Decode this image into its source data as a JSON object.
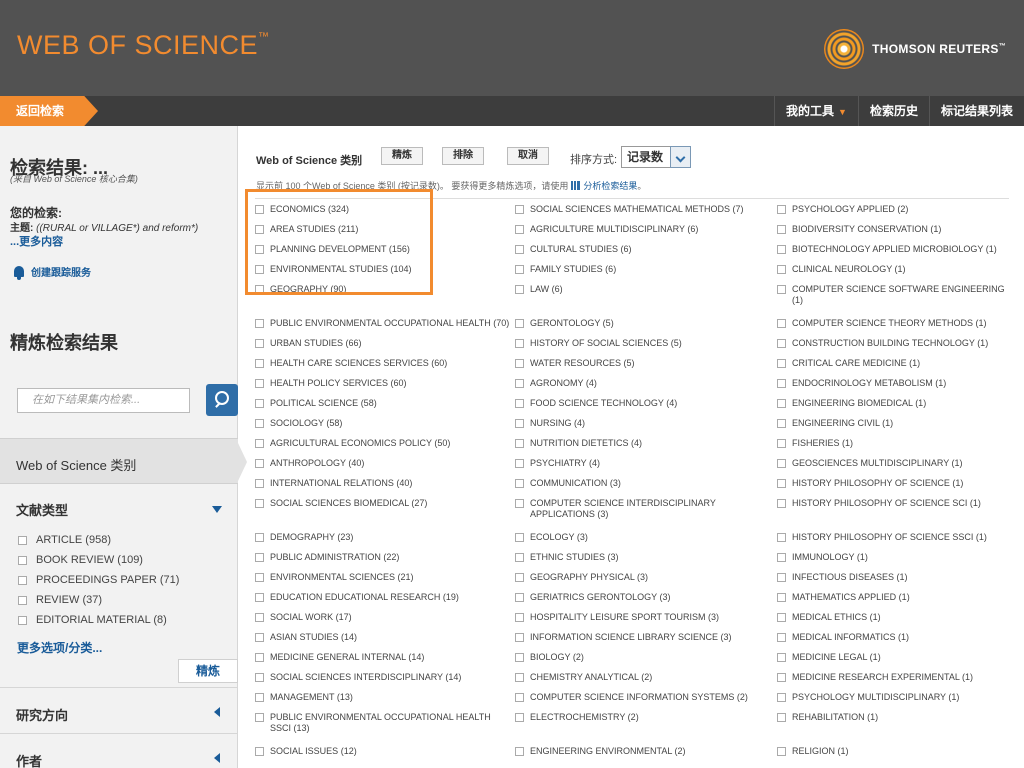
{
  "header": {
    "logo": "WEB OF SCIENCE",
    "logo_tm": "™",
    "publisher": "THOMSON REUTERS",
    "publisher_tm": "™",
    "accent_color": "#f28b2f",
    "bar_color": "#525252"
  },
  "nav": {
    "back": "返回检索",
    "my_tools": "我的工具",
    "history": "检索历史",
    "marked_list": "标记结果列表"
  },
  "sidebar": {
    "results_title": "检索结果: ...",
    "results_sub": "(来自 Web of Science 核心合集)",
    "query_label": "您的检索:",
    "query_field": "主题:",
    "query_text": "((RURAL or VILLAGE*) and reform*)",
    "more_content": "...更多内容",
    "alert": "创建跟踪服务",
    "refine_title": "精炼检索结果",
    "refine_placeholder": "在如下结果集内检索...",
    "active_facet": "Web of Science 类别",
    "doc_type_title": "文献类型",
    "doc_types": [
      "ARTICLE (958)",
      "BOOK REVIEW (109)",
      "PROCEEDINGS PAPER (71)",
      "REVIEW (37)",
      "EDITORIAL MATERIAL (8)"
    ],
    "more_options": "更多选项/分类...",
    "refine_button": "精炼",
    "research_area": "研究方向",
    "authors": "作者"
  },
  "main": {
    "title": "Web of Science 类别",
    "btn_refine": "精炼",
    "btn_exclude": "排除",
    "btn_cancel": "取消",
    "sort_label": "排序方式:",
    "sort_value": "记录数",
    "note": "显示前 100 个Web of Science 类别 (按记录数)。 要获得更多精炼选项，请使用",
    "analyze": "分析检索结果",
    "note_end": "。",
    "col1": [
      "ECONOMICS (324)",
      "AREA STUDIES (211)",
      "PLANNING DEVELOPMENT (156)",
      "ENVIRONMENTAL STUDIES (104)",
      "GEOGRAPHY (90)",
      "PUBLIC ENVIRONMENTAL OCCUPATIONAL HEALTH (70)",
      "URBAN STUDIES (66)",
      "HEALTH CARE SCIENCES SERVICES (60)",
      "HEALTH POLICY SERVICES (60)",
      "POLITICAL SCIENCE (58)",
      "SOCIOLOGY (58)",
      "AGRICULTURAL ECONOMICS POLICY (50)",
      "ANTHROPOLOGY (40)",
      "INTERNATIONAL RELATIONS (40)",
      "SOCIAL SCIENCES BIOMEDICAL (27)",
      "DEMOGRAPHY (23)",
      "PUBLIC ADMINISTRATION (22)",
      "ENVIRONMENTAL SCIENCES (21)",
      "EDUCATION EDUCATIONAL RESEARCH (19)",
      "SOCIAL WORK (17)",
      "ASIAN STUDIES (14)",
      "MEDICINE GENERAL INTERNAL (14)",
      "SOCIAL SCIENCES INTERDISCIPLINARY (14)",
      "MANAGEMENT (13)",
      "PUBLIC ENVIRONMENTAL OCCUPATIONAL HEALTH SSCI (13)",
      "SOCIAL ISSUES (12)"
    ],
    "col2": [
      "SOCIAL SCIENCES MATHEMATICAL METHODS (7)",
      "AGRICULTURE MULTIDISCIPLINARY (6)",
      "CULTURAL STUDIES (6)",
      "FAMILY STUDIES (6)",
      "LAW (6)",
      "GERONTOLOGY (5)",
      "HISTORY OF SOCIAL SCIENCES (5)",
      "WATER RESOURCES (5)",
      "AGRONOMY (4)",
      "FOOD SCIENCE TECHNOLOGY (4)",
      "NURSING (4)",
      "NUTRITION DIETETICS (4)",
      "PSYCHIATRY (4)",
      "COMMUNICATION (3)",
      "COMPUTER SCIENCE INTERDISCIPLINARY APPLICATIONS (3)",
      "ECOLOGY (3)",
      "ETHNIC STUDIES (3)",
      "GEOGRAPHY PHYSICAL (3)",
      "GERIATRICS GERONTOLOGY (3)",
      "HOSPITALITY LEISURE SPORT TOURISM (3)",
      "INFORMATION SCIENCE LIBRARY SCIENCE (3)",
      "BIOLOGY (2)",
      "CHEMISTRY ANALYTICAL (2)",
      "COMPUTER SCIENCE INFORMATION SYSTEMS (2)",
      "ELECTROCHEMISTRY (2)",
      "ENGINEERING ENVIRONMENTAL (2)"
    ],
    "col3": [
      "PSYCHOLOGY APPLIED (2)",
      "BIODIVERSITY CONSERVATION (1)",
      "BIOTECHNOLOGY APPLIED MICROBIOLOGY (1)",
      "CLINICAL NEUROLOGY (1)",
      "COMPUTER SCIENCE SOFTWARE ENGINEERING (1)",
      "COMPUTER SCIENCE THEORY METHODS (1)",
      "CONSTRUCTION BUILDING TECHNOLOGY (1)",
      "CRITICAL CARE MEDICINE (1)",
      "ENDOCRINOLOGY METABOLISM (1)",
      "ENGINEERING BIOMEDICAL (1)",
      "ENGINEERING CIVIL (1)",
      "FISHERIES (1)",
      "GEOSCIENCES MULTIDISCIPLINARY (1)",
      "HISTORY PHILOSOPHY OF SCIENCE (1)",
      "HISTORY PHILOSOPHY OF SCIENCE SCI (1)",
      "HISTORY PHILOSOPHY OF SCIENCE SSCI (1)",
      "IMMUNOLOGY (1)",
      "INFECTIOUS DISEASES (1)",
      "MATHEMATICS APPLIED (1)",
      "MEDICAL ETHICS (1)",
      "MEDICAL INFORMATICS (1)",
      "MEDICINE LEGAL (1)",
      "MEDICINE RESEARCH EXPERIMENTAL (1)",
      "PSYCHOLOGY MULTIDISCIPLINARY (1)",
      "REHABILITATION (1)",
      "RELIGION (1)"
    ]
  }
}
